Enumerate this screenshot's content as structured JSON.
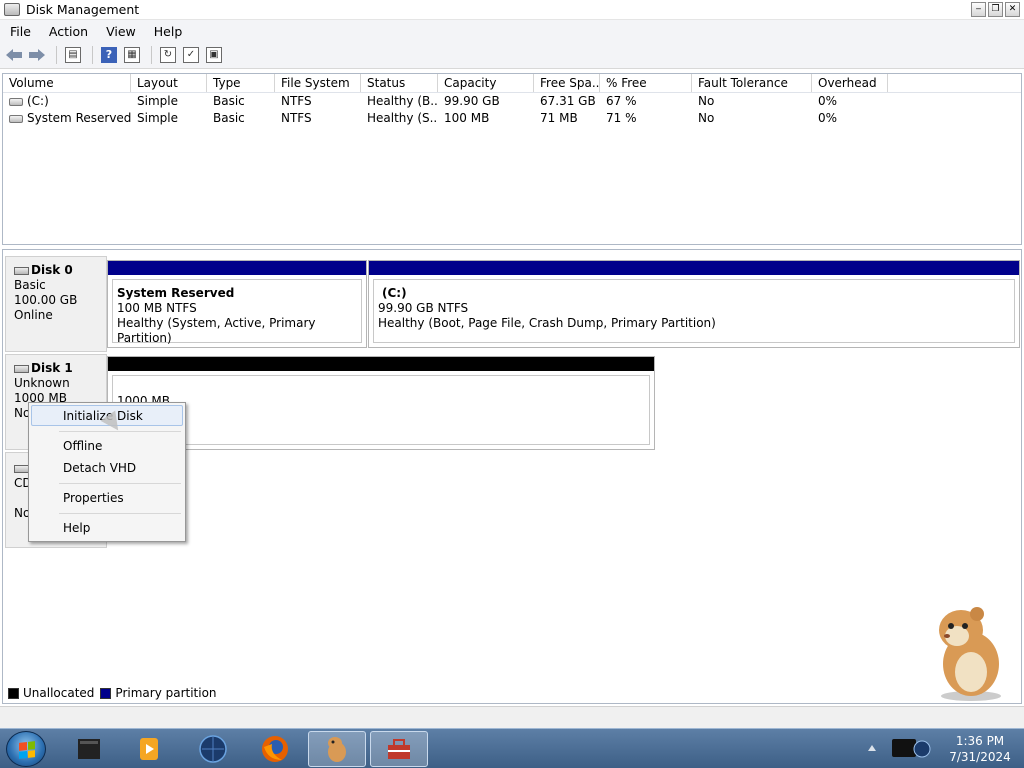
{
  "window": {
    "title": "Disk Management",
    "buttons": {
      "minimize": "‒",
      "restore": "❐",
      "close": "✕"
    }
  },
  "menubar": {
    "items": [
      "File",
      "Action",
      "View",
      "Help"
    ]
  },
  "toolbar": {
    "icons": [
      "back-icon",
      "forward-icon",
      "show-hide-tree-icon",
      "help-icon",
      "properties-icon",
      "refresh-icon",
      "rescan-icon",
      "export-icon"
    ],
    "help_glyph": "?"
  },
  "volumes": {
    "columns": [
      "Volume",
      "Layout",
      "Type",
      "File System",
      "Status",
      "Capacity",
      "Free Spa...",
      "% Free",
      "Fault Tolerance",
      "Overhead"
    ],
    "rows": [
      [
        "(C:)",
        "Simple",
        "Basic",
        "NTFS",
        "Healthy (B...",
        "99.90 GB",
        "67.31 GB",
        "67 %",
        "No",
        "0%"
      ],
      [
        "System Reserved",
        "Simple",
        "Basic",
        "NTFS",
        "Healthy (S...",
        "100 MB",
        "71 MB",
        "71 %",
        "No",
        "0%"
      ]
    ]
  },
  "disks": {
    "disk0": {
      "name": "Disk 0",
      "type": "Basic",
      "size": "100.00 GB",
      "state": "Online",
      "partitions": [
        {
          "title": "System Reserved",
          "size": "100 MB NTFS",
          "status": "Healthy (System, Active, Primary Partition)",
          "bar_color": "#00008b"
        },
        {
          "title": "(C:)",
          "size": "99.90 GB NTFS",
          "status": "Healthy (Boot, Page File, Crash Dump, Primary Partition)",
          "bar_color": "#00008b"
        }
      ]
    },
    "disk1": {
      "name": "Disk 1",
      "type": "Unknown",
      "size": "1000 MB",
      "state_partial": "No",
      "partition": {
        "size": "1000 MB",
        "bar_color": "#000000"
      }
    },
    "cdrom": {
      "name_partial": "CD",
      "state_partial": "No"
    }
  },
  "context_menu": {
    "items": [
      "Initialize Disk",
      "Offline",
      "Detach VHD",
      "Properties",
      "Help"
    ],
    "highlighted": "Initialize Disk"
  },
  "legend": [
    {
      "label": "Unallocated",
      "color": "#000000"
    },
    {
      "label": "Primary partition",
      "color": "#00008b"
    }
  ],
  "taskbar": {
    "apps": [
      "server-manager-icon",
      "media-player-icon",
      "globe-icon",
      "firefox-icon",
      "hamster-icon",
      "toolbox-icon"
    ],
    "clock": {
      "time": "1:36 PM",
      "date": "7/31/2024"
    }
  }
}
